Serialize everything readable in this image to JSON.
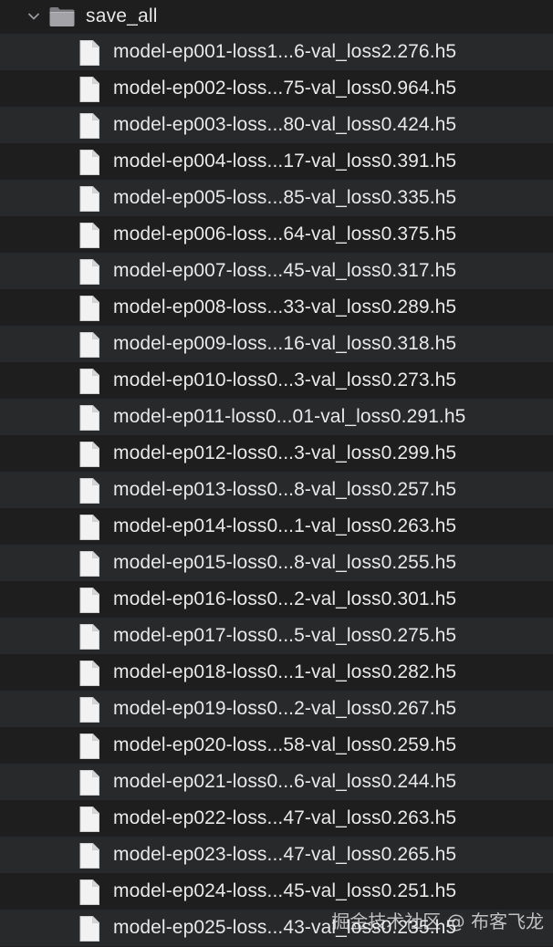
{
  "folder": {
    "name": "save_all",
    "expanded": true
  },
  "files": [
    "model-ep001-loss1...6-val_loss2.276.h5",
    "model-ep002-loss...75-val_loss0.964.h5",
    "model-ep003-loss...80-val_loss0.424.h5",
    "model-ep004-loss...17-val_loss0.391.h5",
    "model-ep005-loss...85-val_loss0.335.h5",
    "model-ep006-loss...64-val_loss0.375.h5",
    "model-ep007-loss...45-val_loss0.317.h5",
    "model-ep008-loss...33-val_loss0.289.h5",
    "model-ep009-loss...16-val_loss0.318.h5",
    "model-ep010-loss0...3-val_loss0.273.h5",
    "model-ep011-loss0...01-val_loss0.291.h5",
    "model-ep012-loss0...3-val_loss0.299.h5",
    "model-ep013-loss0...8-val_loss0.257.h5",
    "model-ep014-loss0...1-val_loss0.263.h5",
    "model-ep015-loss0...8-val_loss0.255.h5",
    "model-ep016-loss0...2-val_loss0.301.h5",
    "model-ep017-loss0...5-val_loss0.275.h5",
    "model-ep018-loss0...1-val_loss0.282.h5",
    "model-ep019-loss0...2-val_loss0.267.h5",
    "model-ep020-loss...58-val_loss0.259.h5",
    "model-ep021-loss0...6-val_loss0.244.h5",
    "model-ep022-loss...47-val_loss0.263.h5",
    "model-ep023-loss...47-val_loss0.265.h5",
    "model-ep024-loss...45-val_loss0.251.h5",
    "model-ep025-loss...43-val_loss0.235.h5"
  ],
  "watermark": "掘金技术社区 @ 布客飞龙",
  "colors": {
    "background": "#1e1e1f",
    "row_alternate": "#28292b",
    "text": "#e8e8e8",
    "folder_icon": "#8e8e93",
    "file_icon": "#f2f2f2"
  }
}
